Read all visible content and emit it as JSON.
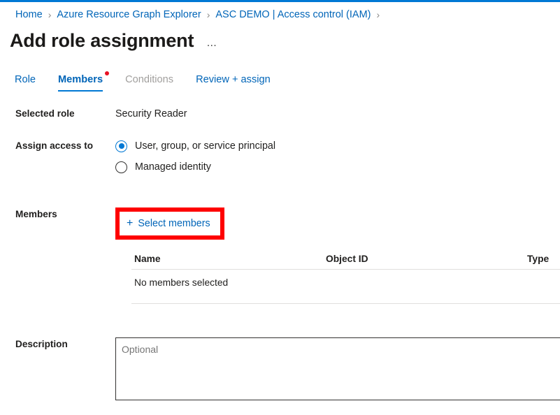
{
  "theme": {
    "accent": "#0078d4",
    "link": "#0065b8",
    "annotation_red": "#fe0000",
    "notification_red": "#e81123",
    "text": "#201f1e",
    "disabled_text": "#a19f9d",
    "border": "#e1dfdd"
  },
  "breadcrumb": {
    "items": [
      {
        "label": "Home"
      },
      {
        "label": "Azure Resource Graph Explorer"
      },
      {
        "label": "ASC DEMO | Access control (IAM)"
      }
    ],
    "separator": "›"
  },
  "header": {
    "title": "Add role assignment",
    "more_menu": "…"
  },
  "tabs": [
    {
      "label": "Role",
      "state": "enabled"
    },
    {
      "label": "Members",
      "state": "active",
      "has_notification_dot": true
    },
    {
      "label": "Conditions",
      "state": "disabled"
    },
    {
      "label": "Review + assign",
      "state": "enabled"
    }
  ],
  "form": {
    "selected_role": {
      "label": "Selected role",
      "value": "Security Reader"
    },
    "assign_access_to": {
      "label": "Assign access to",
      "options": [
        {
          "label": "User, group, or service principal",
          "selected": true
        },
        {
          "label": "Managed identity",
          "selected": false
        }
      ]
    },
    "members": {
      "label": "Members",
      "select_button": "Select members",
      "plus_icon": "+",
      "table": {
        "columns": [
          "Name",
          "Object ID",
          "Type"
        ],
        "empty_message": "No members selected",
        "rows": []
      }
    },
    "description": {
      "label": "Description",
      "value": "",
      "placeholder": "Optional"
    }
  }
}
